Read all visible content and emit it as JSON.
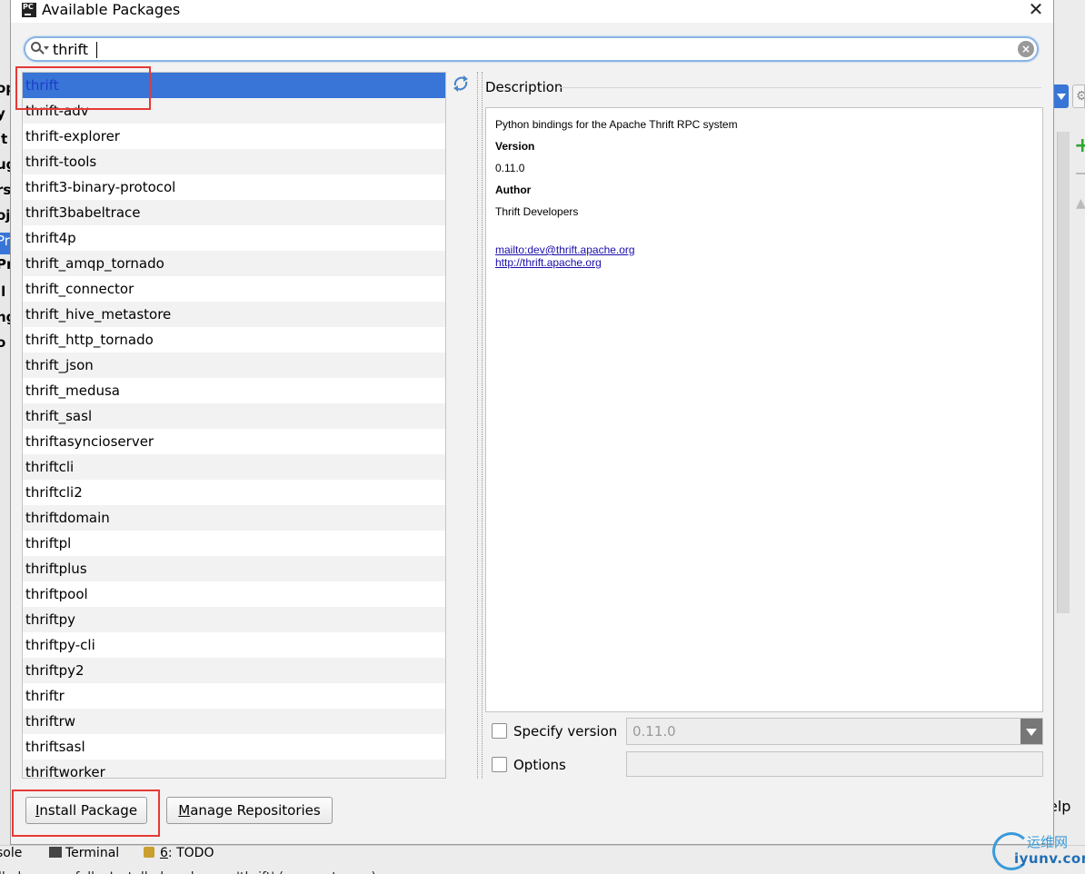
{
  "dialog": {
    "app_icon_text": "PC",
    "title": "Available Packages",
    "close_glyph": "✕"
  },
  "search": {
    "value": "thrift",
    "clear_glyph": "×"
  },
  "packages": [
    "thrift",
    "thrift-adv",
    "thrift-explorer",
    "thrift-tools",
    "thrift3-binary-protocol",
    "thrift3babeltrace",
    "thrift4p",
    "thrift_amqp_tornado",
    "thrift_connector",
    "thrift_hive_metastore",
    "thrift_http_tornado",
    "thrift_json",
    "thrift_medusa",
    "thrift_sasl",
    "thriftasyncioserver",
    "thriftcli",
    "thriftcli2",
    "thriftdomain",
    "thriftpl",
    "thriftplus",
    "thriftpool",
    "thriftpy",
    "thriftpy-cli",
    "thriftpy2",
    "thriftr",
    "thriftrw",
    "thriftsasl",
    "thriftworker"
  ],
  "selected_index": 0,
  "description": {
    "label": "Description",
    "summary": "Python bindings for the Apache Thrift RPC system",
    "version_heading": "Version",
    "version": "0.11.0",
    "author_heading": "Author",
    "author": "Thrift Developers",
    "email_link": "mailto:dev@thrift.apache.org",
    "home_link": "http://thrift.apache.org"
  },
  "specify_version": {
    "label": "Specify version",
    "checked": false,
    "value": "0.11.0"
  },
  "options": {
    "label": "Options",
    "checked": false,
    "value": ""
  },
  "buttons": {
    "install": "Install Package",
    "manage": "Manage Repositories"
  },
  "background": {
    "left_fragments": [
      "op",
      "y",
      "it",
      "ug",
      "rs",
      "oj",
      "Pr",
      "Pr",
      "il",
      "ng",
      "o"
    ],
    "right_help": "elp",
    "bottom_tabs": {
      "console": "sole",
      "terminal": "Terminal",
      "todo_num": "6",
      "todo": ": TODO"
    },
    "status_text": "lled successfully: Installed packages: 'thrift' (moments ago)"
  },
  "watermark": {
    "cn": "运维网",
    "en": "iyunv.com"
  },
  "colors": {
    "selection": "#3875d7",
    "highlight_box": "#e53935",
    "link": "#1a0dab"
  }
}
